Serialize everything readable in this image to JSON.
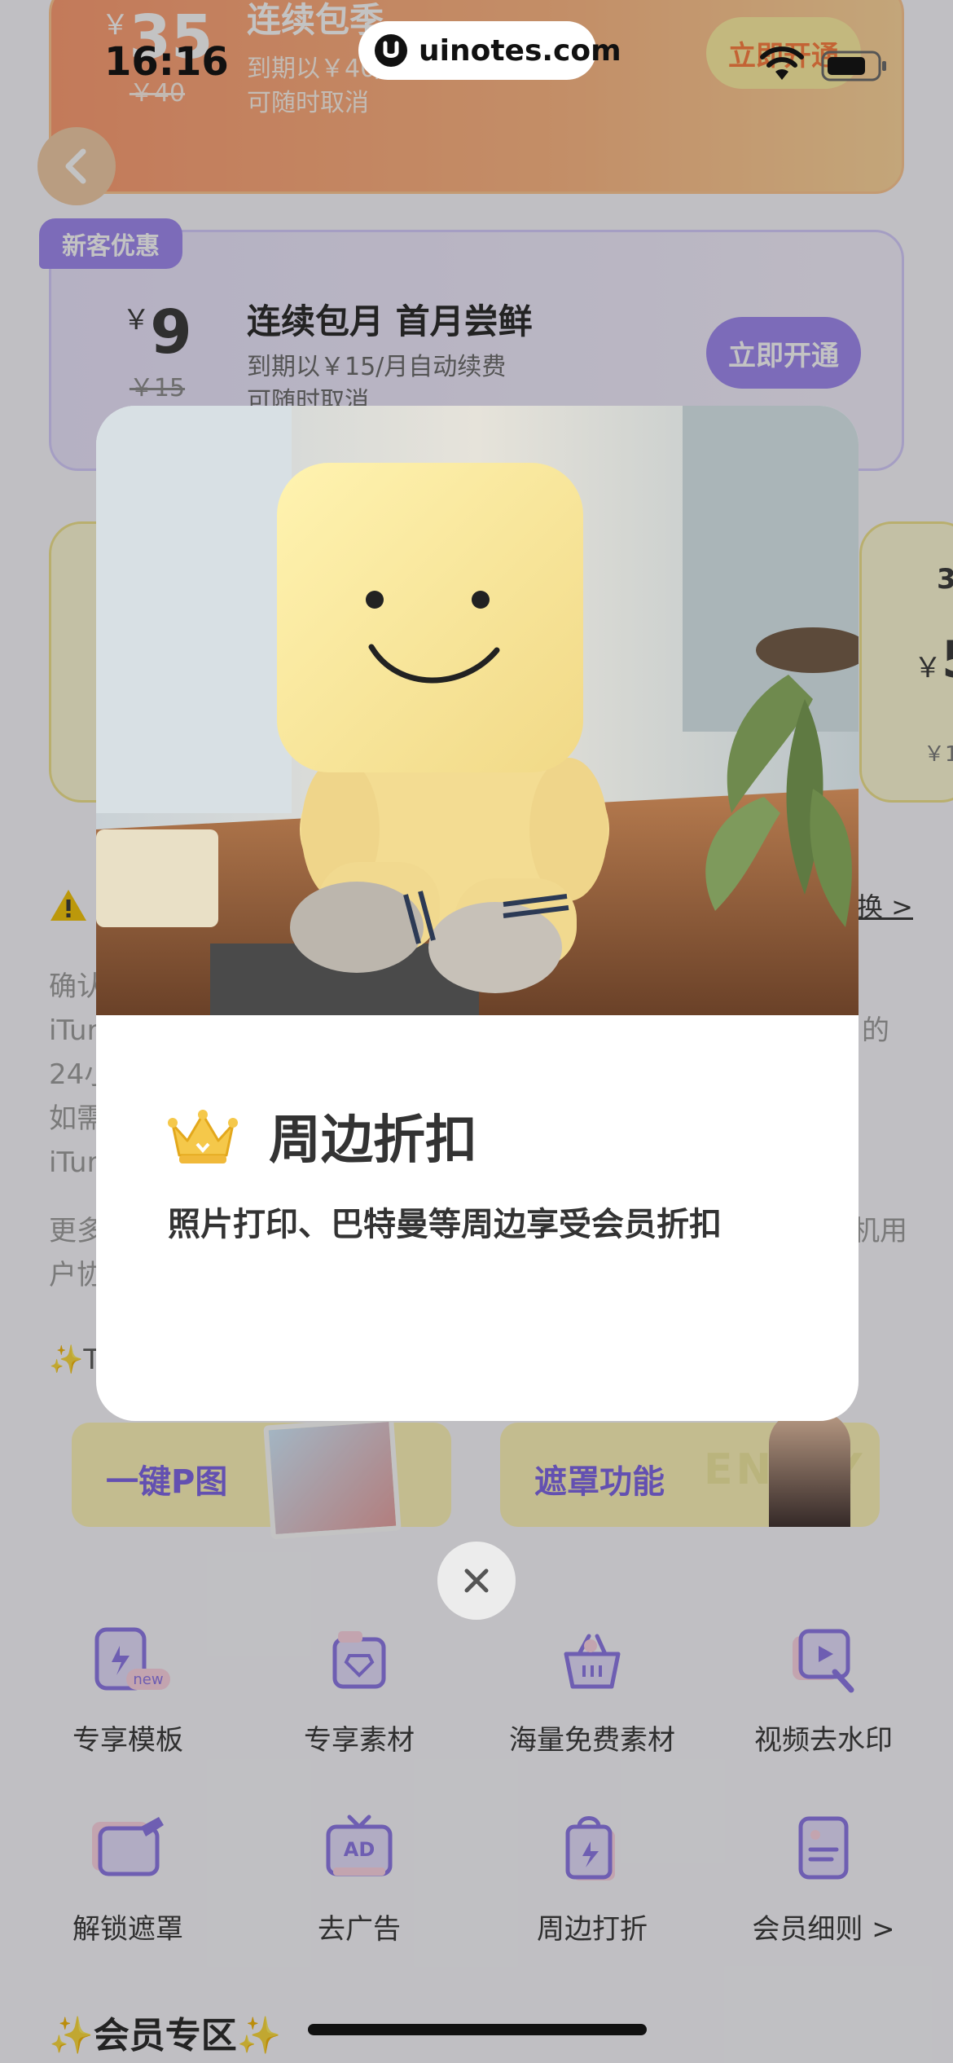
{
  "status_bar": {
    "time": "16:16",
    "url": "uinotes.com"
  },
  "plan_top": {
    "price": "35",
    "price_old": "￥40",
    "title": "连续包季",
    "line1": "到期以￥40/季自动续费",
    "line2": "可随时取消",
    "button": "立即开通"
  },
  "plan_mid": {
    "badge": "新客优惠",
    "currency": "￥",
    "price": "9",
    "price_old": "￥15",
    "title": "连续包月 首月尝鲜",
    "line1": "到期以￥15/月自动续费",
    "line2": "可随时取消",
    "button": "立即开通"
  },
  "small_card_right": {
    "r1": "3",
    "currency": "￥",
    "r2": "5",
    "r3": "￥1"
  },
  "change_link": "换 >",
  "faint_text": {
    "l1a": "确认",
    "l2a": "iTur",
    "l2b": "的",
    "l3a": "24小",
    "l4a": "如需",
    "l5a": "iTur",
    "l6a": "更多",
    "l6b": "机用",
    "l7a": "户协",
    "section_prefix": "✨T"
  },
  "feature_banners": {
    "left": "一键P图",
    "right": "遮罩功能",
    "enjoy": "ENJOY"
  },
  "benefits": [
    {
      "label": "专享模板",
      "icon": "template-icon"
    },
    {
      "label": "专享素材",
      "icon": "diamond-material-icon"
    },
    {
      "label": "海量免费素材",
      "icon": "basket-icon"
    },
    {
      "label": "视频去水印",
      "icon": "video-watermark-icon"
    },
    {
      "label": "解锁遮罩",
      "icon": "mask-icon"
    },
    {
      "label": "去广告",
      "icon": "ad-tv-icon"
    },
    {
      "label": "周边打折",
      "icon": "shopping-bag-icon"
    },
    {
      "label": "会员细则 >",
      "icon": "document-icon"
    }
  ],
  "benefit_new_tag": "new",
  "section_title": "✨会员专区✨",
  "modal": {
    "title": "周边折扣",
    "description": "照片打印、巴特曼等周边享受会员折扣"
  },
  "colors": {
    "accent_purple": "#9d86f2",
    "accent_orange": "#ff9a6e",
    "crown_gold": "#f5c84a"
  }
}
